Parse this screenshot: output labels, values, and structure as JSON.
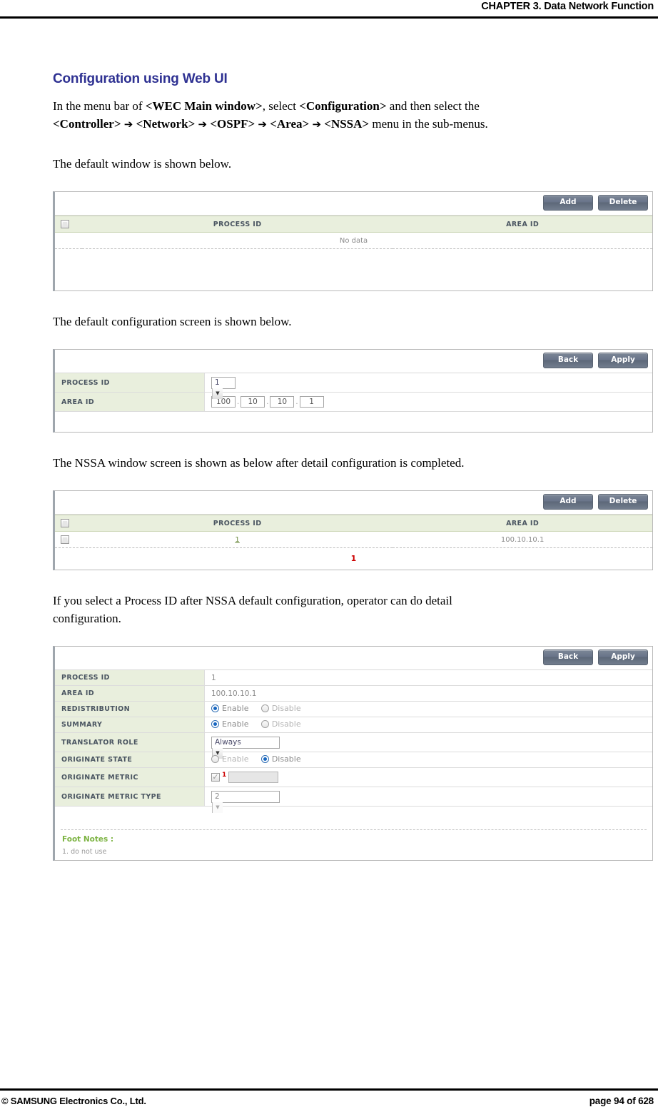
{
  "header": {
    "chapter": "CHAPTER 3. Data Network Function"
  },
  "footer": {
    "copyright": "© SAMSUNG Electronics Co., Ltd.",
    "page": "page 94 of 628"
  },
  "section": {
    "heading": "Configuration using Web UI",
    "intro_1": "In the menu bar of ",
    "intro_b1": "<WEC Main window>",
    "intro_2": ", select ",
    "intro_b2": "<Configuration>",
    "intro_3": " and then select the ",
    "path_b1": "<Controller>",
    "arrow": "➔",
    "path_b2": "<Network>",
    "path_b3": "<OSPF>",
    "path_b4": "<Area>",
    "path_b5": "<NSSA>",
    "path_tail": " menu in the sub-menus.",
    "caption_default_window": "The default window is shown below.",
    "caption_default_config": "The default configuration screen is shown below.",
    "caption_nssa_window": "The NSSA window screen is shown as below after detail configuration is completed.",
    "caption_detail_1": "If you select a Process ID after NSSA default configuration, operator can do detail",
    "caption_detail_2": "configuration."
  },
  "colors": {
    "heading": "#2e3192",
    "table_header_bg": "#e9efdd",
    "button_bg": "#69748a",
    "link": "#6c8a3f",
    "footnote_marker": "#cc0000",
    "footnote_title": "#7cb342",
    "radio_on": "#1565c0"
  },
  "panel_list_empty": {
    "buttons": [
      {
        "label": "Add",
        "name": "add-button"
      },
      {
        "label": "Delete",
        "name": "delete-button"
      }
    ],
    "columns": [
      "PROCESS ID",
      "AREA ID"
    ],
    "empty_text": "No data"
  },
  "panel_default_config": {
    "buttons": [
      {
        "label": "Back",
        "name": "back-button"
      },
      {
        "label": "Apply",
        "name": "apply-button"
      }
    ],
    "rows": [
      {
        "label": "PROCESS ID",
        "value": "1"
      },
      {
        "label": "AREA ID",
        "value": "100.10.10.1"
      }
    ],
    "process_id_selected": "1",
    "area_id_octets": [
      "100",
      "10",
      "10",
      "1"
    ],
    "octet_separator": "."
  },
  "panel_nssa_list": {
    "buttons": [
      {
        "label": "Add",
        "name": "add-button"
      },
      {
        "label": "Delete",
        "name": "delete-button"
      }
    ],
    "columns": [
      "PROCESS ID",
      "AREA ID"
    ],
    "rows": [
      {
        "process_id": "1",
        "area_id": "100.10.10.1"
      }
    ],
    "pager": "1"
  },
  "panel_detail_config": {
    "buttons": [
      {
        "label": "Back",
        "name": "back-button"
      },
      {
        "label": "Apply",
        "name": "apply-button"
      }
    ],
    "rows": {
      "process_id_label": "PROCESS ID",
      "process_id_value": "1",
      "area_id_label": "AREA ID",
      "area_id_value": "100.10.10.1",
      "redistribution_label": "REDISTRIBUTION",
      "summary_label": "SUMMARY",
      "translator_role_label": "TRANSLATOR ROLE",
      "translator_role_value": "Always",
      "originate_state_label": "ORIGINATE STATE",
      "originate_metric_label": "ORIGINATE METRIC",
      "originate_metric_value": "",
      "originate_metric_footnote": "1",
      "originate_metric_type_label": "ORIGINATE METRIC TYPE",
      "originate_metric_type_value": "2"
    },
    "radio_options": {
      "enable": "Enable",
      "disable": "Disable"
    },
    "selections": {
      "redistribution": "Enable",
      "summary": "Enable",
      "originate_state": "Disable"
    },
    "footnotes": {
      "title": "Foot Notes :",
      "items": [
        "1. do not use"
      ]
    }
  }
}
